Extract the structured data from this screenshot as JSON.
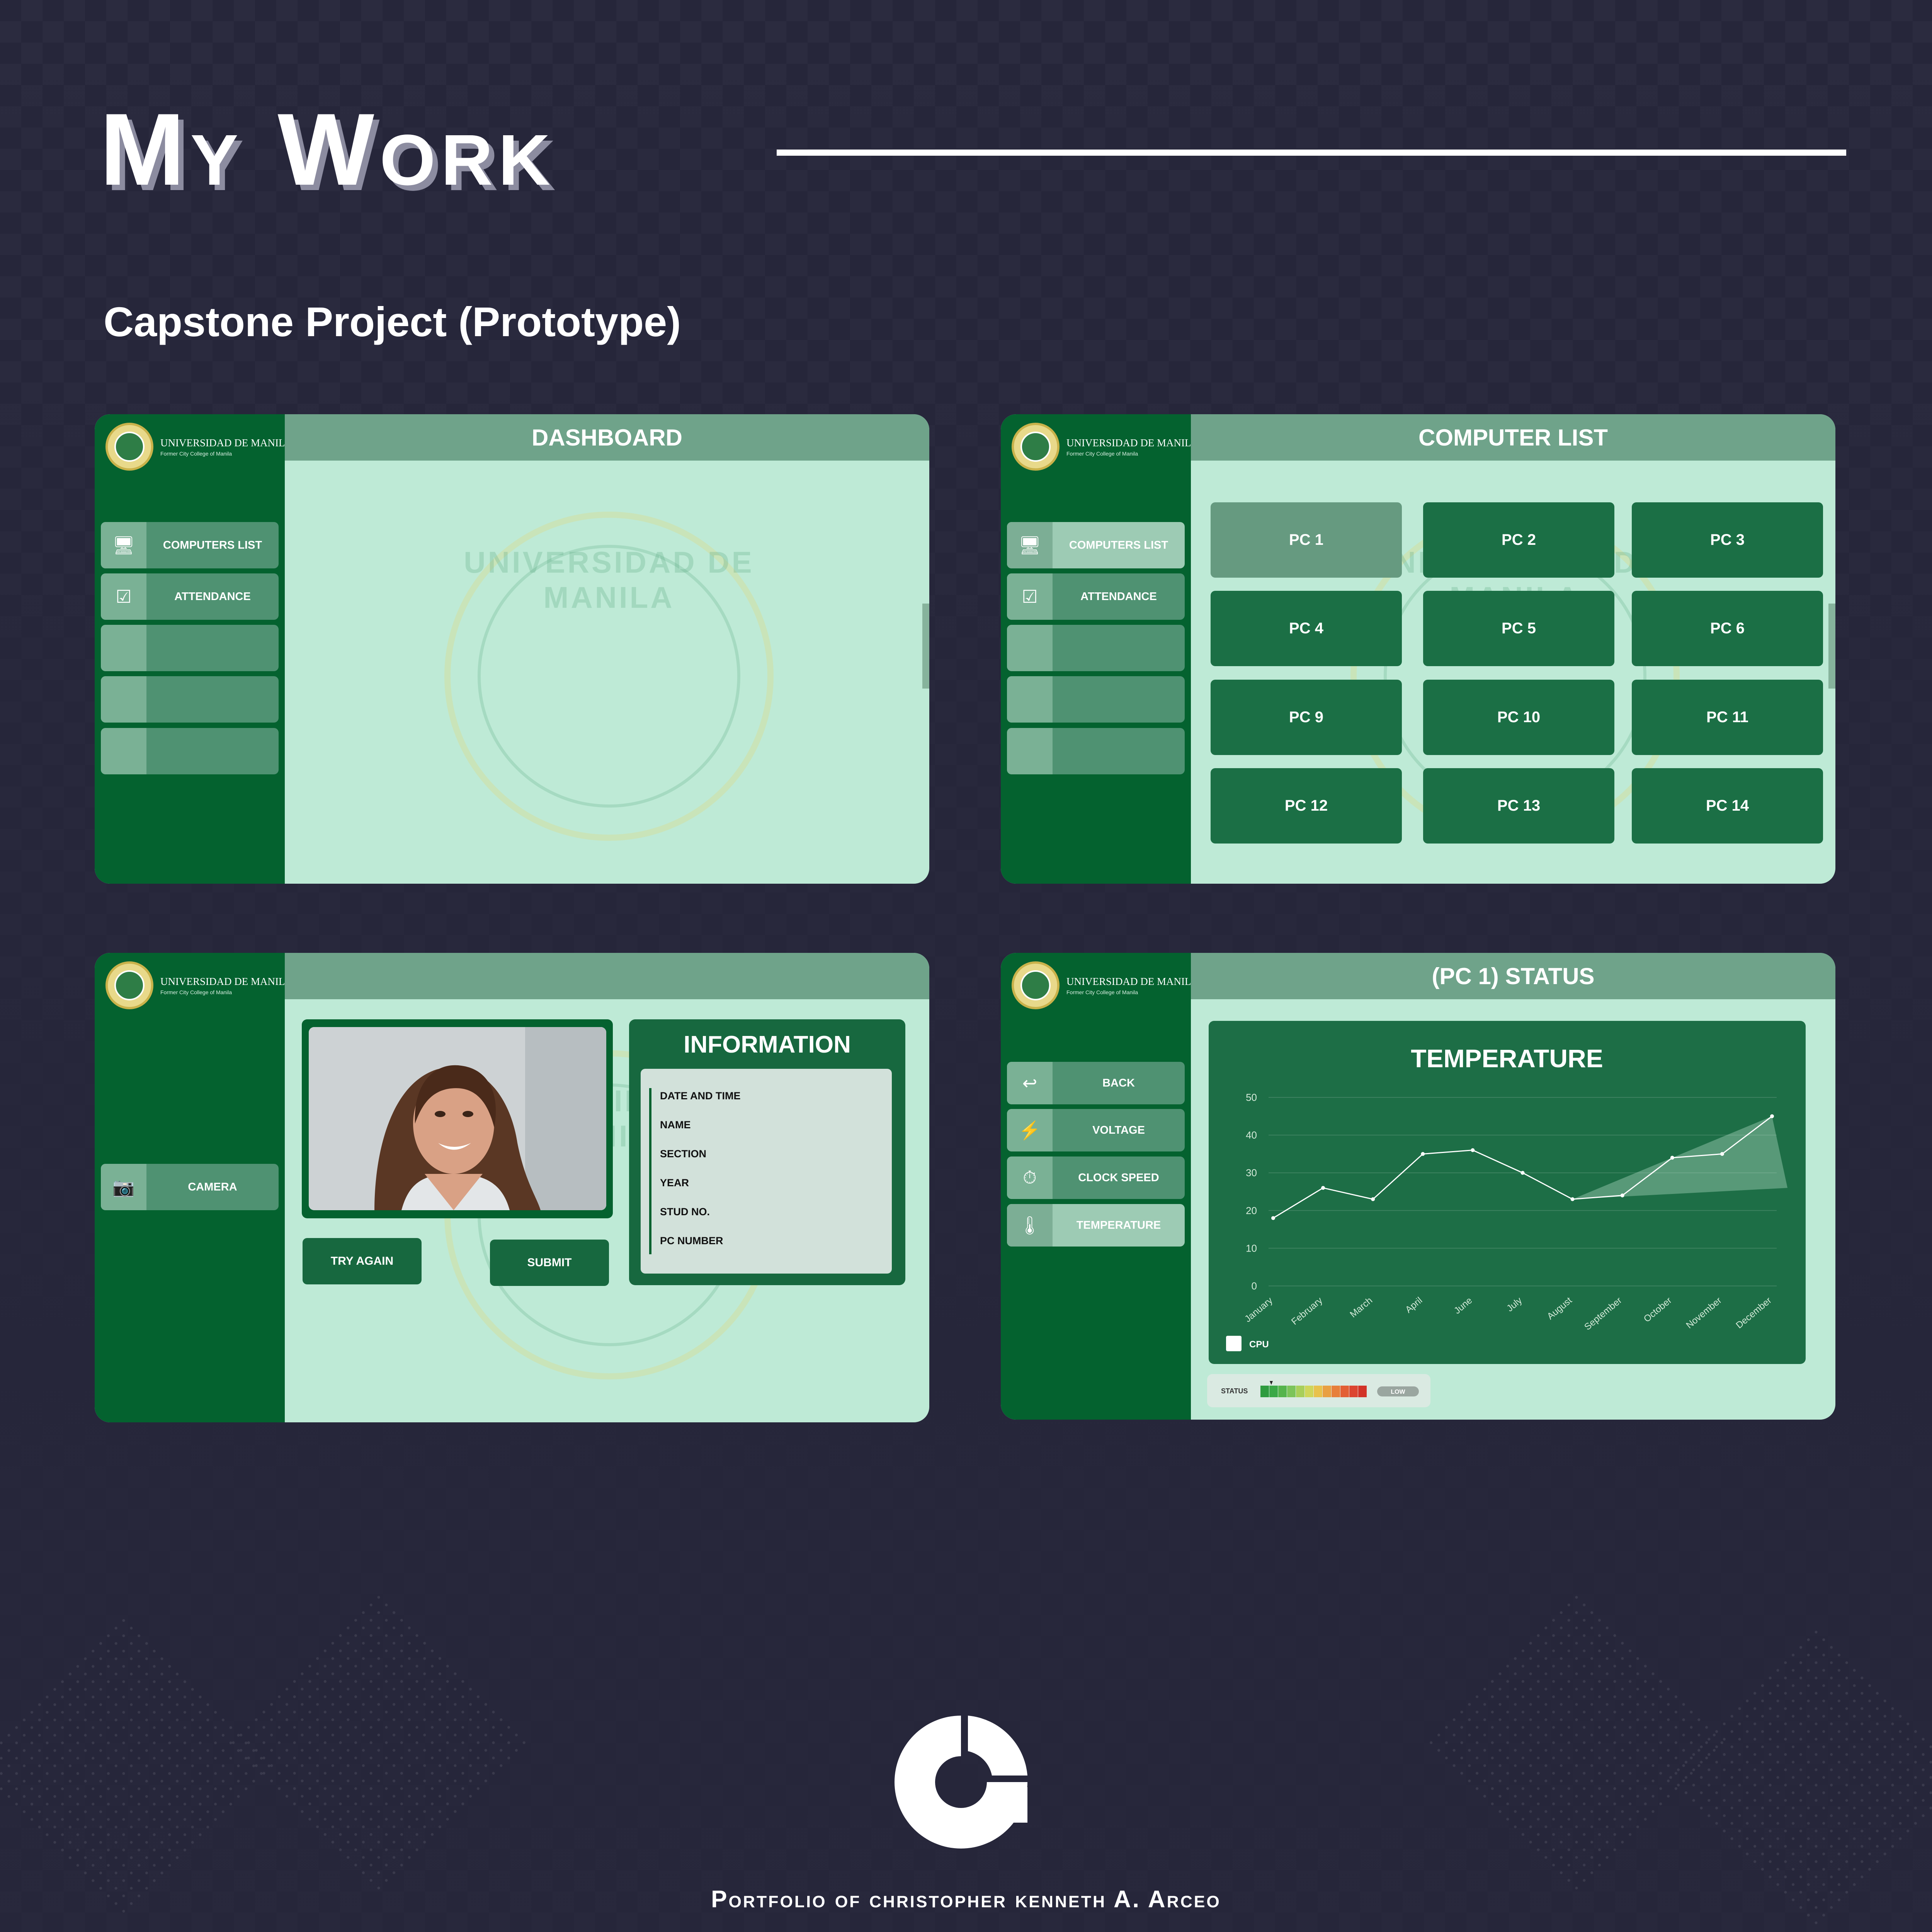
{
  "page": {
    "title": "My Work",
    "subtitle": "Capstone Project (Prototype)",
    "footer": "Portfolio of christopher kenneth A. Arceo"
  },
  "brand": {
    "university": "UNIVERSIDAD DE MANILA",
    "university_sub": "Former City College of Manila",
    "watermark_text": "UNIVERSIDAD DE MANILA"
  },
  "colors": {
    "page_bg": "#26263a",
    "sidebar": "#04622f",
    "header": "#6fa38a",
    "content_bg": "#beead6",
    "button": "#4f9272",
    "tile": "#1b6f45"
  },
  "dashboard": {
    "header": "DASHBOARD",
    "nav": [
      {
        "icon": "monitor-icon",
        "label": "COMPUTERS LIST"
      },
      {
        "icon": "checkbox-icon",
        "label": "ATTENDANCE"
      },
      {
        "icon": "",
        "label": ""
      },
      {
        "icon": "",
        "label": ""
      },
      {
        "icon": "",
        "label": ""
      }
    ]
  },
  "computer_list": {
    "header": "COMPUTER LIST",
    "nav": [
      {
        "icon": "monitor-icon",
        "label": "COMPUTERS LIST",
        "active": true
      },
      {
        "icon": "checkbox-icon",
        "label": "ATTENDANCE"
      },
      {
        "icon": "",
        "label": ""
      },
      {
        "icon": "",
        "label": ""
      },
      {
        "icon": "",
        "label": ""
      }
    ],
    "pcs": [
      "PC 1",
      "PC 2",
      "PC 3",
      "PC 4",
      "PC 5",
      "PC 6",
      "PC 9",
      "PC 10",
      "PC 11",
      "PC 12",
      "PC 13",
      "PC 14"
    ],
    "selected": "PC 1"
  },
  "attendance": {
    "header": "",
    "nav_camera": "CAMERA",
    "info_title": "INFORMATION",
    "fields": [
      "DATE AND TIME",
      "NAME",
      "SECTION",
      "YEAR",
      "STUD NO.",
      "PC NUMBER"
    ],
    "try_again": "TRY AGAIN",
    "submit": "SUBMIT"
  },
  "status": {
    "header": "(PC 1) STATUS",
    "nav": [
      {
        "icon": "back-arrow-icon",
        "label": "BACK"
      },
      {
        "icon": "lightning-icon",
        "label": "VOLTAGE"
      },
      {
        "icon": "stopwatch-icon",
        "label": "CLOCK SPEED"
      },
      {
        "icon": "thermometer-icon",
        "label": "TEMPERATURE",
        "active": true
      }
    ],
    "status_label": "STATUS",
    "status_level": "LOW"
  },
  "chart_data": {
    "type": "line",
    "title": "TEMPERATURE",
    "categories": [
      "January",
      "February",
      "March",
      "April",
      "June",
      "July",
      "August",
      "September",
      "October",
      "November",
      "December"
    ],
    "series": [
      {
        "name": "CPU",
        "values": [
          18,
          26,
          23,
          35,
          36,
          30,
          23,
          24,
          34,
          35,
          45
        ]
      }
    ],
    "ylim": [
      0,
      50
    ],
    "yticks": [
      0,
      10,
      20,
      30,
      40,
      50
    ],
    "grid": true,
    "legend": "bottom-left"
  }
}
